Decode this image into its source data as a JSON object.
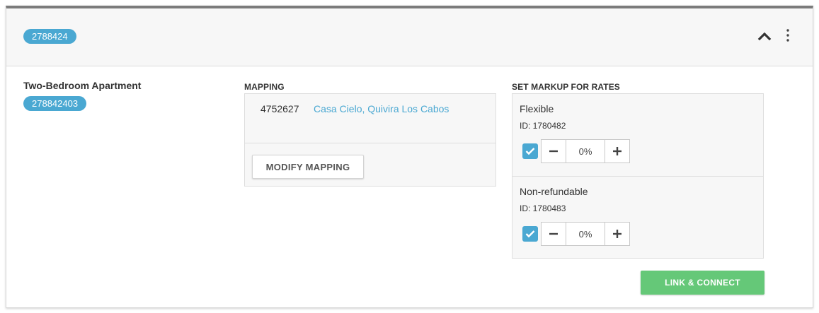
{
  "header": {
    "id_badge": "2788424",
    "collapse_icon": "chevron-up-icon",
    "menu_icon": "vertical-dots-icon"
  },
  "room": {
    "name": "Two-Bedroom Apartment",
    "id_badge": "278842403"
  },
  "mapping": {
    "label": "MAPPING",
    "property_id": "4752627",
    "property_link": "Casa Cielo, Quivira  Los Cabos",
    "modify_button": "MODIFY MAPPING"
  },
  "markup": {
    "label": "SET MARKUP FOR RATES",
    "rates": [
      {
        "name": "Flexible",
        "id_text": "ID: 1780482",
        "checked": true,
        "value": "0%"
      },
      {
        "name": "Non-refundable",
        "id_text": "ID: 1780483",
        "checked": true,
        "value": "0%"
      }
    ]
  },
  "actions": {
    "link_connect": "LINK & CONNECT"
  },
  "colors": {
    "accent_blue": "#4aa8d2",
    "success_green": "#65c878",
    "header_border": "#7b7b7b"
  }
}
